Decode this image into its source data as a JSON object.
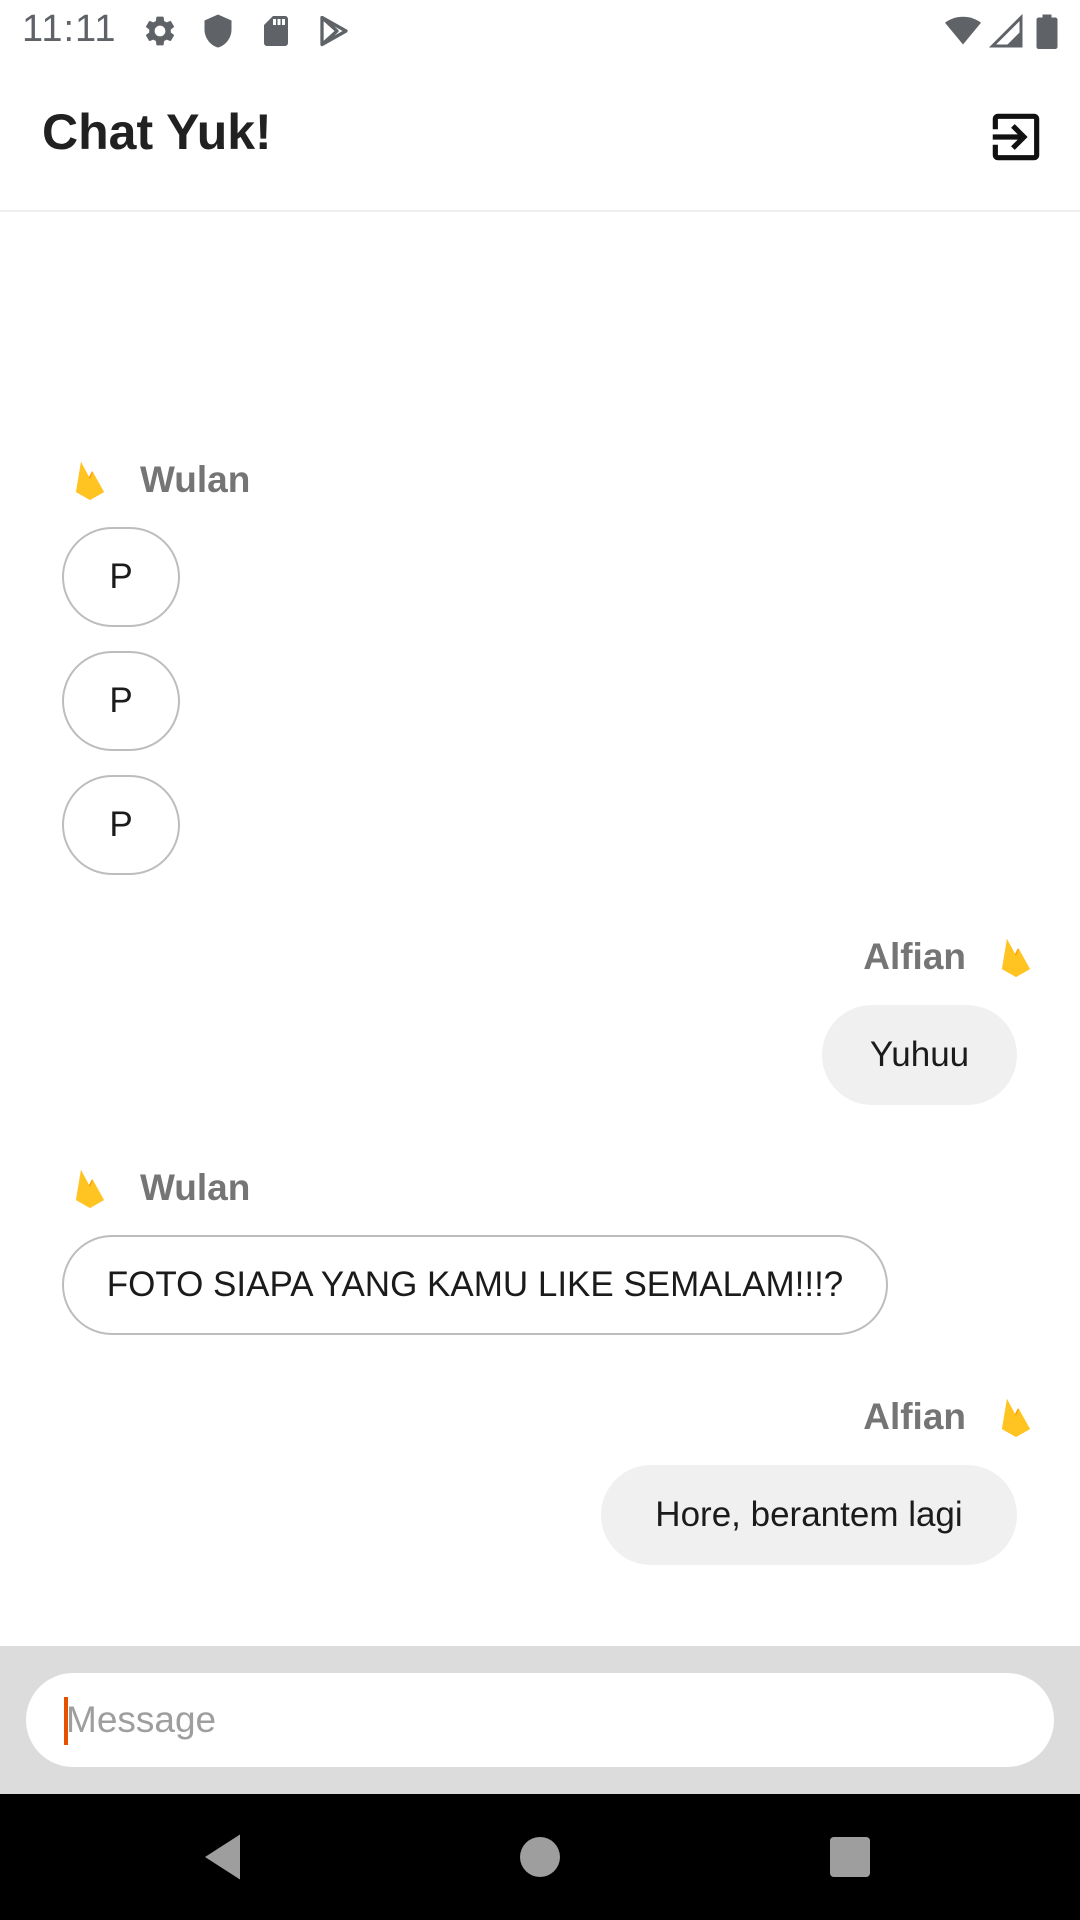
{
  "status_bar": {
    "time": "11:11",
    "left_icons": [
      "settings-icon",
      "shield-icon",
      "sd-card-icon",
      "play-store-icon"
    ],
    "right_icons": [
      "wifi-icon",
      "signal-icon",
      "battery-icon"
    ]
  },
  "app_bar": {
    "title": "Chat Yuk!",
    "action_icon": "logout-icon"
  },
  "messages": [
    {
      "sender": "Wulan",
      "direction": "incoming",
      "text": "P"
    },
    {
      "sender": "Wulan",
      "direction": "incoming",
      "text": "P"
    },
    {
      "sender": "Wulan",
      "direction": "incoming",
      "text": "P"
    },
    {
      "sender": "Alfian",
      "direction": "outgoing",
      "text": "Yuhuu"
    },
    {
      "sender": "Wulan",
      "direction": "incoming",
      "text": "FOTO SIAPA YANG KAMU LIKE SEMALAM!!!?"
    },
    {
      "sender": "Alfian",
      "direction": "outgoing",
      "text": "Hore, berantem lagi"
    }
  ],
  "senders": [
    "Wulan",
    "Alfian",
    "Wulan",
    "Alfian"
  ],
  "composer": {
    "placeholder": "Message",
    "value": ""
  },
  "nav_bar": {
    "icons": [
      "back-icon",
      "home-icon",
      "recents-icon"
    ]
  },
  "colors": {
    "incoming_bubble_border": "#bdbdbd",
    "outgoing_bubble_bg": "#f0f0f0",
    "sender_name": "#757575",
    "input_bar_bg": "#dcdcdc",
    "cursor": "#e65100",
    "fire_icon": "#ffca28"
  }
}
